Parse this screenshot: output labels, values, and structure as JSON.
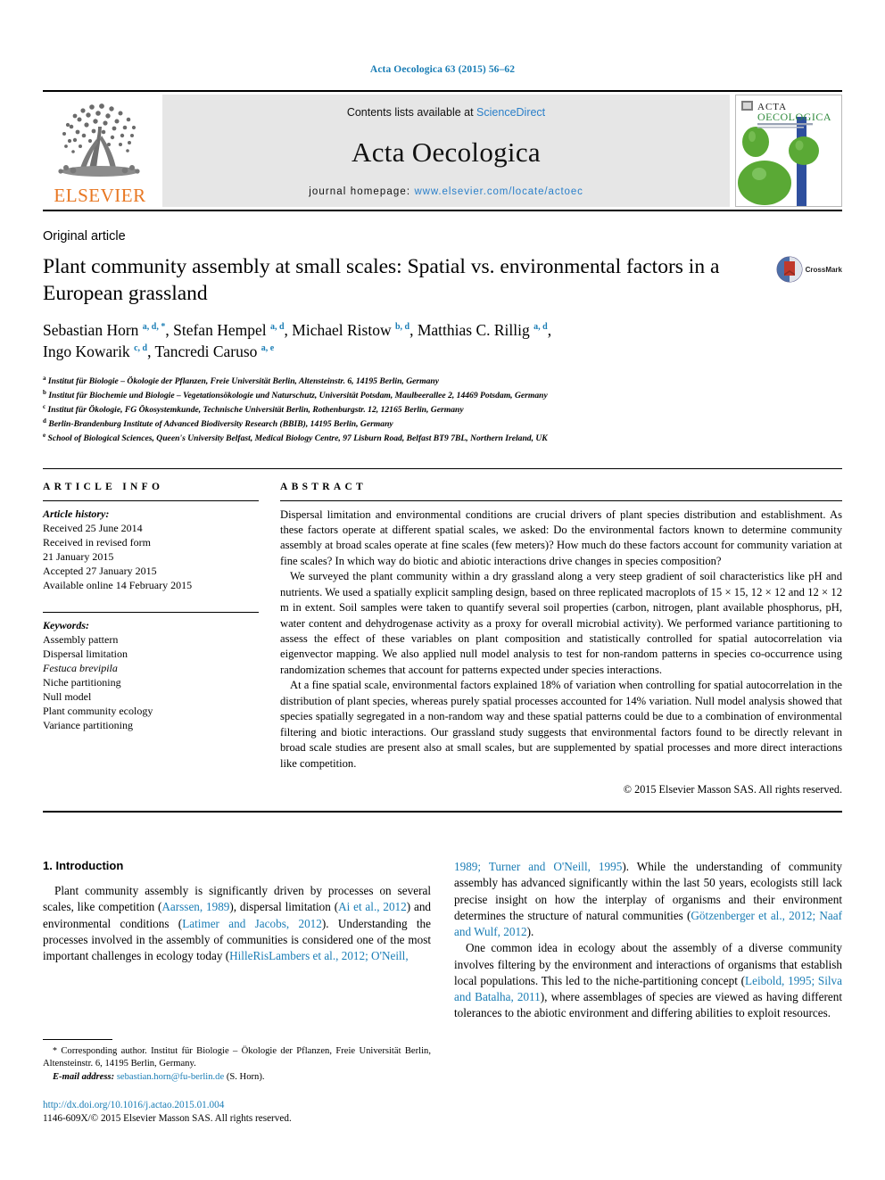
{
  "running_head": "Acta Oecologica 63 (2015) 56–62",
  "masthead": {
    "publisher_logo_text": "ELSEVIER",
    "contents_prefix": "Contents lists available at ",
    "contents_link": "ScienceDirect",
    "journal_title": "Acta Oecologica",
    "homepage_prefix": "journal homepage: ",
    "homepage_url": "www.elsevier.com/locate/actoec",
    "cover": {
      "line1": "ACTA",
      "line2": "OECOLOGICA"
    }
  },
  "article": {
    "kind": "Original article",
    "title": "Plant community assembly at small scales: Spatial vs. environmental factors in a European grassland",
    "crossmark_label": "CrossMark",
    "authors_line1": "Sebastian Horn",
    "authors_line1_sup": "a, d, *",
    "authors_rest": ", Stefan Hempel ",
    "authors_html": "Sebastian Horn <sup>a, d, *</sup>, Stefan Hempel <sup>a, d</sup>, Michael Ristow <sup>b, d</sup>, Matthias C. Rillig <sup>a, d</sup>, Ingo Kowarik <sup>c, d</sup>, Tancredi Caruso <sup>a, e</sup>",
    "affiliations": [
      {
        "marker": "a",
        "text": "Institut für Biologie – Ökologie der Pflanzen, Freie Universität Berlin, Altensteinstr. 6, 14195 Berlin, Germany"
      },
      {
        "marker": "b",
        "text": "Institut für Biochemie und Biologie – Vegetationsökologie und Naturschutz, Universität Potsdam, Maulbeerallee 2, 14469 Potsdam, Germany"
      },
      {
        "marker": "c",
        "text": "Institut für Ökologie, FG Ökosystemkunde, Technische Universität Berlin, Rothenburgstr. 12, 12165 Berlin, Germany"
      },
      {
        "marker": "d",
        "text": "Berlin-Brandenburg Institute of Advanced Biodiversity Research (BBIB), 14195 Berlin, Germany"
      },
      {
        "marker": "e",
        "text": "School of Biological Sciences, Queen's University Belfast, Medical Biology Centre, 97 Lisburn Road, Belfast BT9 7BL, Northern Ireland, UK"
      }
    ]
  },
  "article_info": {
    "heading": "ARTICLE INFO",
    "history_label": "Article history:",
    "history": [
      "Received 25 June 2014",
      "Received in revised form",
      "21 January 2015",
      "Accepted 27 January 2015",
      "Available online 14 February 2015"
    ],
    "keywords_label": "Keywords:",
    "keywords": [
      "Assembly pattern",
      "Dispersal limitation",
      "Festuca brevipila",
      "Niche partitioning",
      "Null model",
      "Plant community ecology",
      "Variance partitioning"
    ],
    "keywords_italic_index": 2
  },
  "abstract": {
    "heading": "ABSTRACT",
    "paragraphs": [
      "Dispersal limitation and environmental conditions are crucial drivers of plant species distribution and establishment. As these factors operate at different spatial scales, we asked: Do the environmental factors known to determine community assembly at broad scales operate at fine scales (few meters)? How much do these factors account for community variation at fine scales? In which way do biotic and abiotic interactions drive changes in species composition?",
      "We surveyed the plant community within a dry grassland along a very steep gradient of soil characteristics like pH and nutrients. We used a spatially explicit sampling design, based on three replicated macroplots of 15 × 15, 12 × 12 and 12 × 12 m in extent. Soil samples were taken to quantify several soil properties (carbon, nitrogen, plant available phosphorus, pH, water content and dehydrogenase activity as a proxy for overall microbial activity). We performed variance partitioning to assess the effect of these variables on plant composition and statistically controlled for spatial autocorrelation via eigenvector mapping. We also applied null model analysis to test for non-random patterns in species co-occurrence using randomization schemes that account for patterns expected under species interactions.",
      "At a fine spatial scale, environmental factors explained 18% of variation when controlling for spatial autocorrelation in the distribution of plant species, whereas purely spatial processes accounted for 14% variation. Null model analysis showed that species spatially segregated in a non-random way and these spatial patterns could be due to a combination of environmental filtering and biotic interactions. Our grassland study suggests that environmental factors found to be directly relevant in broad scale studies are present also at small scales, but are supplemented by spatial processes and more direct interactions like competition."
    ],
    "copyright": "© 2015 Elsevier Masson SAS. All rights reserved."
  },
  "introduction": {
    "heading": "1. Introduction",
    "left_paragraph_parts": [
      {
        "t": "Plant community assembly is significantly driven by processes on several scales, like competition ("
      },
      {
        "t": "Aarssen, 1989",
        "link": true
      },
      {
        "t": "), dispersal limitation ("
      },
      {
        "t": "Ai et al., 2012",
        "link": true
      },
      {
        "t": ") and environmental conditions ("
      },
      {
        "t": "Latimer and Jacobs, 2012",
        "link": true
      },
      {
        "t": "). Understanding the processes involved in the assembly of communities is considered one of the most important challenges in ecology today ("
      },
      {
        "t": "HilleRisLambers et al., 2012; O'Neill,",
        "link": true
      }
    ],
    "right_paragraph1_parts": [
      {
        "t": "1989; Turner and O'Neill, 1995",
        "link": true
      },
      {
        "t": "). While the understanding of community assembly has advanced significantly within the last 50 years, ecologists still lack precise insight on how the interplay of organisms and their environment determines the structure of natural communities ("
      },
      {
        "t": "Götzenberger et al., 2012; Naaf and Wulf, 2012",
        "link": true
      },
      {
        "t": ")."
      }
    ],
    "right_paragraph2_parts": [
      {
        "t": "One common idea in ecology about the assembly of a diverse community involves filtering by the environment and interactions of organisms that establish local populations. This led to the niche-partitioning concept ("
      },
      {
        "t": "Leibold, 1995; Silva and Batalha, 2011",
        "link": true
      },
      {
        "t": "), where assemblages of species are viewed as having different tolerances to the abiotic environment and differing abilities to exploit resources."
      }
    ]
  },
  "footnote": {
    "star": "*",
    "corresponding": " Corresponding author. Institut für Biologie – Ökologie der Pflanzen, Freie Universität Berlin, Altensteinstr. 6, 14195 Berlin, Germany.",
    "email_label": "E-mail address:",
    "email": "sebastian.horn@fu-berlin.de",
    "email_suffix": " (S. Horn).",
    "doi": "http://dx.doi.org/10.1016/j.actao.2015.01.004",
    "issn": "1146-609X/© 2015 Elsevier Masson SAS. All rights reserved."
  },
  "colors": {
    "link": "#1a7db5",
    "elsevier_orange": "#E87722",
    "sciencedirect_blue": "#2a7fc9",
    "cover_green": "#5aa935",
    "cover_blue": "#2e4f9e"
  }
}
